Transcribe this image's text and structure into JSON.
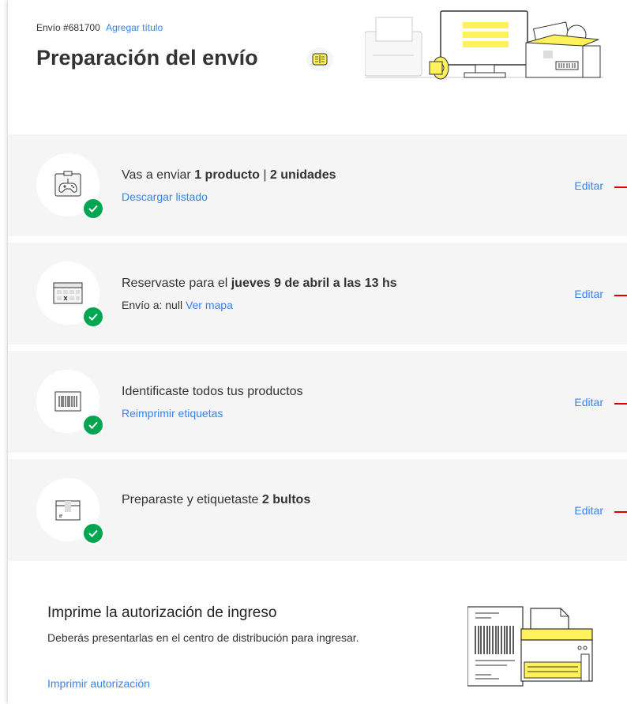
{
  "header": {
    "shipment_id": "Envío #681700",
    "add_title": "Agregar título",
    "title": "Preparación del envío"
  },
  "steps": [
    {
      "icon": "gamepad-box-icon",
      "title_pre": "Vas a enviar ",
      "title_b1": "1 producto",
      "title_mid": " | ",
      "title_b2": "2 unidades",
      "sub_text": "",
      "sub_link": "Descargar listado",
      "edit": "Editar"
    },
    {
      "icon": "calendar-icon",
      "title_pre": "Reservaste para el ",
      "title_b1": "jueves 9 de abril a las 13 hs",
      "sub_text": "Envío a: null",
      "sub_link": "Ver mapa",
      "edit": "Editar"
    },
    {
      "icon": "barcode-label-icon",
      "title_pre": "Identificaste todos tus productos",
      "sub_text": "",
      "sub_link": "Reimprimir etiquetas",
      "edit": "Editar"
    },
    {
      "icon": "package-box-icon",
      "title_pre": "Preparaste y etiquetaste ",
      "title_b1": "2 bultos",
      "edit": "Editar"
    }
  ],
  "authorization": {
    "title": "Imprime la autorización de ingreso",
    "description": "Deberás presentarlas en el centro de distribución para ingresar.",
    "link": "Imprimir autorización"
  },
  "colors": {
    "link": "#3483fa",
    "check": "#00a650",
    "accent_yellow": "#fff159",
    "marker_red": "#e00000"
  }
}
